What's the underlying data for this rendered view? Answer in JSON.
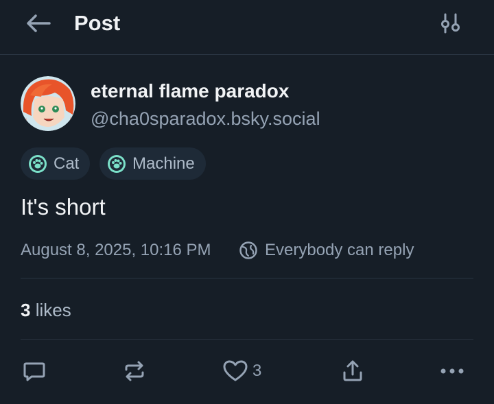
{
  "header": {
    "title": "Post",
    "back_icon": "arrow-left-icon",
    "settings_icon": "sliders-icon"
  },
  "post": {
    "author": {
      "display_name": "eternal flame paradox",
      "handle": "@cha0sparadox.bsky.social",
      "avatar_icon": "avatar-image"
    },
    "labels": [
      {
        "text": "Cat",
        "icon": "paw-icon"
      },
      {
        "text": "Machine",
        "icon": "paw-icon"
      }
    ],
    "text": "It's short",
    "timestamp": "August 8, 2025, 10:16 PM",
    "reply_setting": "Everybody can reply",
    "likes": {
      "count": "3",
      "label": "likes"
    }
  },
  "actions": {
    "reply": {
      "icon": "comment-icon"
    },
    "repost": {
      "icon": "repost-icon"
    },
    "like": {
      "icon": "heart-icon",
      "count": "3"
    },
    "share": {
      "icon": "share-icon"
    },
    "more": {
      "icon": "more-icon"
    }
  },
  "colors": {
    "background": "#161e27",
    "text_primary": "#f1f3f5",
    "text_secondary": "#95a3b4",
    "chip_bg": "#1e2a37",
    "accent_label": "#7be0c9"
  }
}
